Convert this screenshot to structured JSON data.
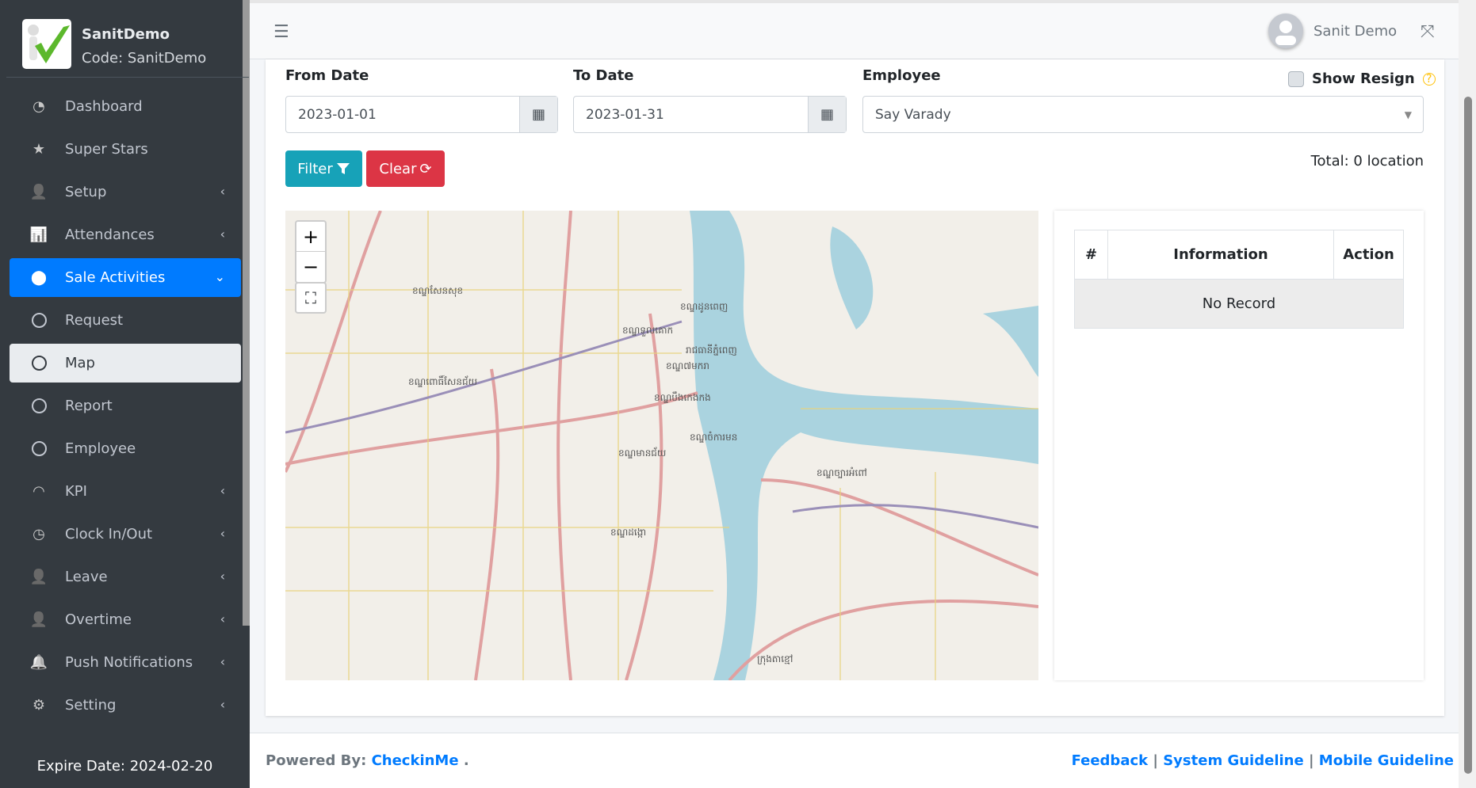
{
  "brand": {
    "name": "SanitDemo",
    "code": "Code: SanitDemo"
  },
  "sidebar": {
    "items": [
      {
        "label": "Dashboard",
        "icon": "tachometer-icon"
      },
      {
        "label": "Super Stars",
        "icon": "star-icon"
      },
      {
        "label": "Setup",
        "icon": "user-cog-icon",
        "chevron": "left"
      },
      {
        "label": "Attendances",
        "icon": "chart-bar-icon",
        "chevron": "left"
      },
      {
        "label": "Sale Activities",
        "icon": "map-marker-icon",
        "chevron": "down",
        "active": true
      },
      {
        "label": "Request",
        "icon": "circle-icon"
      },
      {
        "label": "Map",
        "icon": "circle-icon",
        "selected": true
      },
      {
        "label": "Report",
        "icon": "circle-icon"
      },
      {
        "label": "Employee",
        "icon": "circle-icon"
      },
      {
        "label": "KPI",
        "icon": "satellite-dish-icon",
        "chevron": "left"
      },
      {
        "label": "Clock In/Out",
        "icon": "clock-icon",
        "chevron": "left"
      },
      {
        "label": "Leave",
        "icon": "user-minus-icon",
        "chevron": "left"
      },
      {
        "label": "Overtime",
        "icon": "user-clock-icon",
        "chevron": "left"
      },
      {
        "label": "Push Notifications",
        "icon": "bell-icon",
        "chevron": "left"
      },
      {
        "label": "Setting",
        "icon": "cogs-icon",
        "chevron": "left"
      }
    ],
    "expire": "Expire Date: 2024-02-20"
  },
  "header": {
    "user": "Sanit Demo"
  },
  "filters": {
    "from_label": "From Date",
    "from_value": "2023-01-01",
    "to_label": "To Date",
    "to_value": "2023-01-31",
    "employee_label": "Employee",
    "employee_value": "Say Varady",
    "show_resign": "Show Resign",
    "show_resign_checked": false,
    "filter_btn": "Filter",
    "clear_btn": "Clear",
    "total": "Total: 0 location"
  },
  "table": {
    "headers": [
      "#",
      "Information",
      "Action"
    ],
    "empty": "No Record"
  },
  "map": {
    "labels": [
      "ខណ្ឌសែនសុខ",
      "ខណ្ឌទួលគោក",
      "ខណ្ឌដូនពេញ",
      "រាជធានីភ្នំពេញ",
      "ខណ្ឌ៧មករា",
      "ខណ្ឌពោធិ៍សែនជ័យ",
      "ខណ្ឌបឹងកេងកង",
      "ខណ្ឌចំការមន",
      "ខណ្ឌមានជ័យ",
      "ខណ្ឌច្បារអំពៅ",
      "ខណ្ឌដង្កោ",
      "ក្រុងតាខ្មៅ"
    ]
  },
  "footer": {
    "powered": "Powered By:",
    "brand": "CheckinMe",
    "dot": " .",
    "links": [
      "Feedback",
      "System Guideline",
      "Mobile Guideline"
    ],
    "sep": " | "
  },
  "colors": {
    "primary": "#007bff",
    "filter": "#17a2b8",
    "clear": "#dc3545",
    "sidebar": "#343a40"
  }
}
